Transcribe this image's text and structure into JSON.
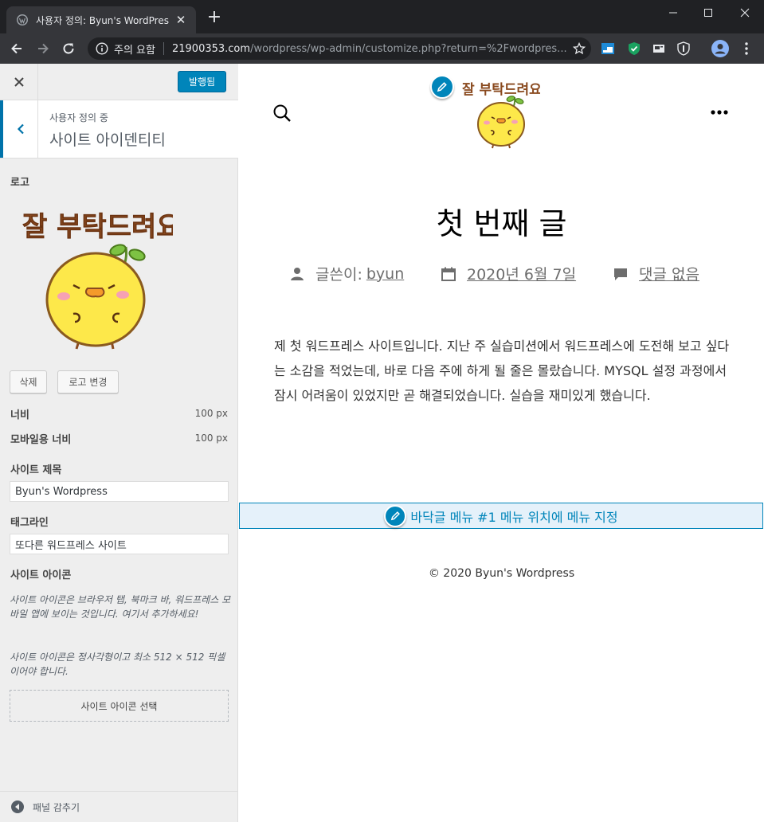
{
  "browser": {
    "tab_title": "사용자 정의: Byun's WordPress",
    "security_label": "주의 요함",
    "url_host": "21900353.com",
    "url_path": "/wordpress/wp-admin/customize.php?return=%2Fwordpres..."
  },
  "customizer": {
    "publish_label": "발행됨",
    "crumb": "사용자 정의 중",
    "section_name": "사이트 아이덴티티",
    "logo_label": "로고",
    "logo_text": "잘 부탁드려요",
    "remove_label": "삭제",
    "change_logo_label": "로고 변경",
    "width_label": "너비",
    "width_value": "100 px",
    "mobile_width_label": "모바일용 너비",
    "mobile_width_value": "100 px",
    "site_title_label": "사이트 제목",
    "site_title_value": "Byun's Wordpress",
    "tagline_label": "태그라인",
    "tagline_value": "또다른 워드프레스 사이트",
    "site_icon_label": "사이트 아이콘",
    "site_icon_desc1": "사이트 아이콘은 브라우저 탭, 북마크 바, 워드프레스 모바일 앱에 보이는 것입니다. 여기서 추가하세요!",
    "site_icon_desc2": "사이트 아이콘은 정사각형이고 최소 512 × 512 픽셀이어야 합니다.",
    "select_icon_label": "사이트 아이콘 선택",
    "collapse_label": "패널 감추기"
  },
  "preview": {
    "logo_text": "잘 부탁드려요",
    "post_title": "첫 번째 글",
    "author_prefix": "글쓴이:",
    "author": "byun",
    "date": "2020년 6월 7일",
    "comments": "댓글 없음",
    "body": "제 첫 워드프레스 사이트입니다. 지난 주 실습미션에서 워드프레스에 도전해 보고 싶다는 소감을 적었는데, 바로 다음 주에 하게 될 줄은 몰랐습니다. MYSQL 설정 과정에서 잠시 어려움이 있었지만 곧 해결되었습니다. 실습을 재미있게 했습니다.",
    "footer_menu_notice": "바닥글 메뉴 #1 메뉴 위치에 메뉴 지정",
    "copyright": "© 2020  Byun's Wordpress"
  }
}
